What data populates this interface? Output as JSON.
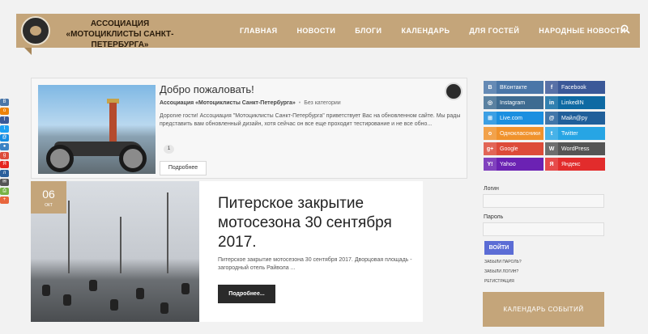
{
  "header": {
    "brand_line1": "АССОЦИАЦИЯ",
    "brand_line2": "«МОТОЦИКЛИСТЫ САНКТ-ПЕТЕРБУРГА»",
    "nav": [
      {
        "label": "ГЛАВНАЯ"
      },
      {
        "label": "НОВОСТИ"
      },
      {
        "label": "БЛОГИ"
      },
      {
        "label": "КАЛЕНДАРЬ"
      },
      {
        "label": "ДЛЯ ГОСТЕЙ"
      },
      {
        "label": "НАРОДНЫЕ НОВОСТИ"
      }
    ],
    "search_icon": "search-icon"
  },
  "share_bar": {
    "buttons": [
      {
        "icon": "vk-icon",
        "glyph": "В",
        "color": "#4a76a8"
      },
      {
        "icon": "ok-icon",
        "glyph": "о",
        "color": "#ee8208"
      },
      {
        "icon": "facebook-icon",
        "glyph": "f",
        "color": "#3b5998"
      },
      {
        "icon": "twitter-icon",
        "glyph": "t",
        "color": "#1da1f2"
      },
      {
        "icon": "moimir-icon",
        "glyph": "@",
        "color": "#168de2"
      },
      {
        "icon": "livejournal-icon",
        "glyph": "●",
        "color": "#3b82c4"
      },
      {
        "icon": "googleplus-icon",
        "glyph": "g",
        "color": "#dd4b39"
      },
      {
        "icon": "yandex-icon",
        "glyph": "Я",
        "color": "#e52620"
      },
      {
        "icon": "livejournal2-icon",
        "glyph": "л",
        "color": "#2b5f9b"
      },
      {
        "icon": "mail-icon",
        "glyph": "✉",
        "color": "#555555"
      },
      {
        "icon": "print-icon",
        "glyph": "⎙",
        "color": "#77b346"
      },
      {
        "icon": "more-icon",
        "glyph": "+",
        "color": "#e8663d"
      }
    ]
  },
  "welcome_post": {
    "title": "Добро пожаловать!",
    "author": "Ассоциация «Мотоциклисты Санкт-Петербурга»",
    "category": "Без категории",
    "excerpt": "Дорогие гости! Ассоциация \"Мотоциклисты Санкт-Петербурга\" приветствует Вас на обновленном сайте. Мы рады представить вам обновленный дизайн, хотя сейчас он все еще проходит тестирование и не все обно...",
    "comments": "1",
    "more": "Подробнее"
  },
  "featured_post": {
    "day": "06",
    "month": "ОКТ",
    "title": "Питерское закрытие мотосезона 30 сентября 2017.",
    "excerpt": "Питерское закрытие мотосезона 30 сентября 2017. Дворцовая площадь - загородный отель Райвола ...",
    "more": "Подробнее..."
  },
  "sidebar": {
    "social": [
      {
        "label": "ВКонтакте",
        "icon": "vk-icon",
        "glyph": "В",
        "color": "#4a76a8"
      },
      {
        "label": "Facebook",
        "icon": "facebook-icon",
        "glyph": "f",
        "color": "#3b5998"
      },
      {
        "label": "Instagram",
        "icon": "instagram-icon",
        "glyph": "◎",
        "color": "#3e6b91"
      },
      {
        "label": "LinkedIN",
        "icon": "linkedin-icon",
        "glyph": "in",
        "color": "#0e6aa3"
      },
      {
        "label": "Live.com",
        "icon": "windows-icon",
        "glyph": "⊞",
        "color": "#1b8fe0"
      },
      {
        "label": "Майл@ру",
        "icon": "mailru-icon",
        "glyph": "@",
        "color": "#205f9a"
      },
      {
        "label": "Одноклассники",
        "icon": "ok-icon",
        "glyph": "о",
        "color": "#f0922c"
      },
      {
        "label": "Twitter",
        "icon": "twitter-icon",
        "glyph": "t",
        "color": "#27a5e4"
      },
      {
        "label": "Google",
        "icon": "google-icon",
        "glyph": "g+",
        "color": "#dd4b39"
      },
      {
        "label": "WordPress",
        "icon": "wordpress-icon",
        "glyph": "W",
        "color": "#555555"
      },
      {
        "label": "Yahoo",
        "icon": "yahoo-icon",
        "glyph": "Y!",
        "color": "#6b22b3"
      },
      {
        "label": "Яндекс",
        "icon": "yandex-icon",
        "glyph": "Я",
        "color": "#e22c2c"
      }
    ],
    "login_label": "Логин",
    "password_label": "Пароль",
    "login_value": "",
    "password_value": "",
    "submit": "ВОЙТИ",
    "forgot_password": "ЗАБЫЛИ ПАРОЛЬ?",
    "forgot_login": "ЗАБЫЛИ ЛОГИН?",
    "register": "РЕГИСТРАЦИЯ",
    "calendar": "КАЛЕНДАРЬ СОБЫТИЙ"
  }
}
